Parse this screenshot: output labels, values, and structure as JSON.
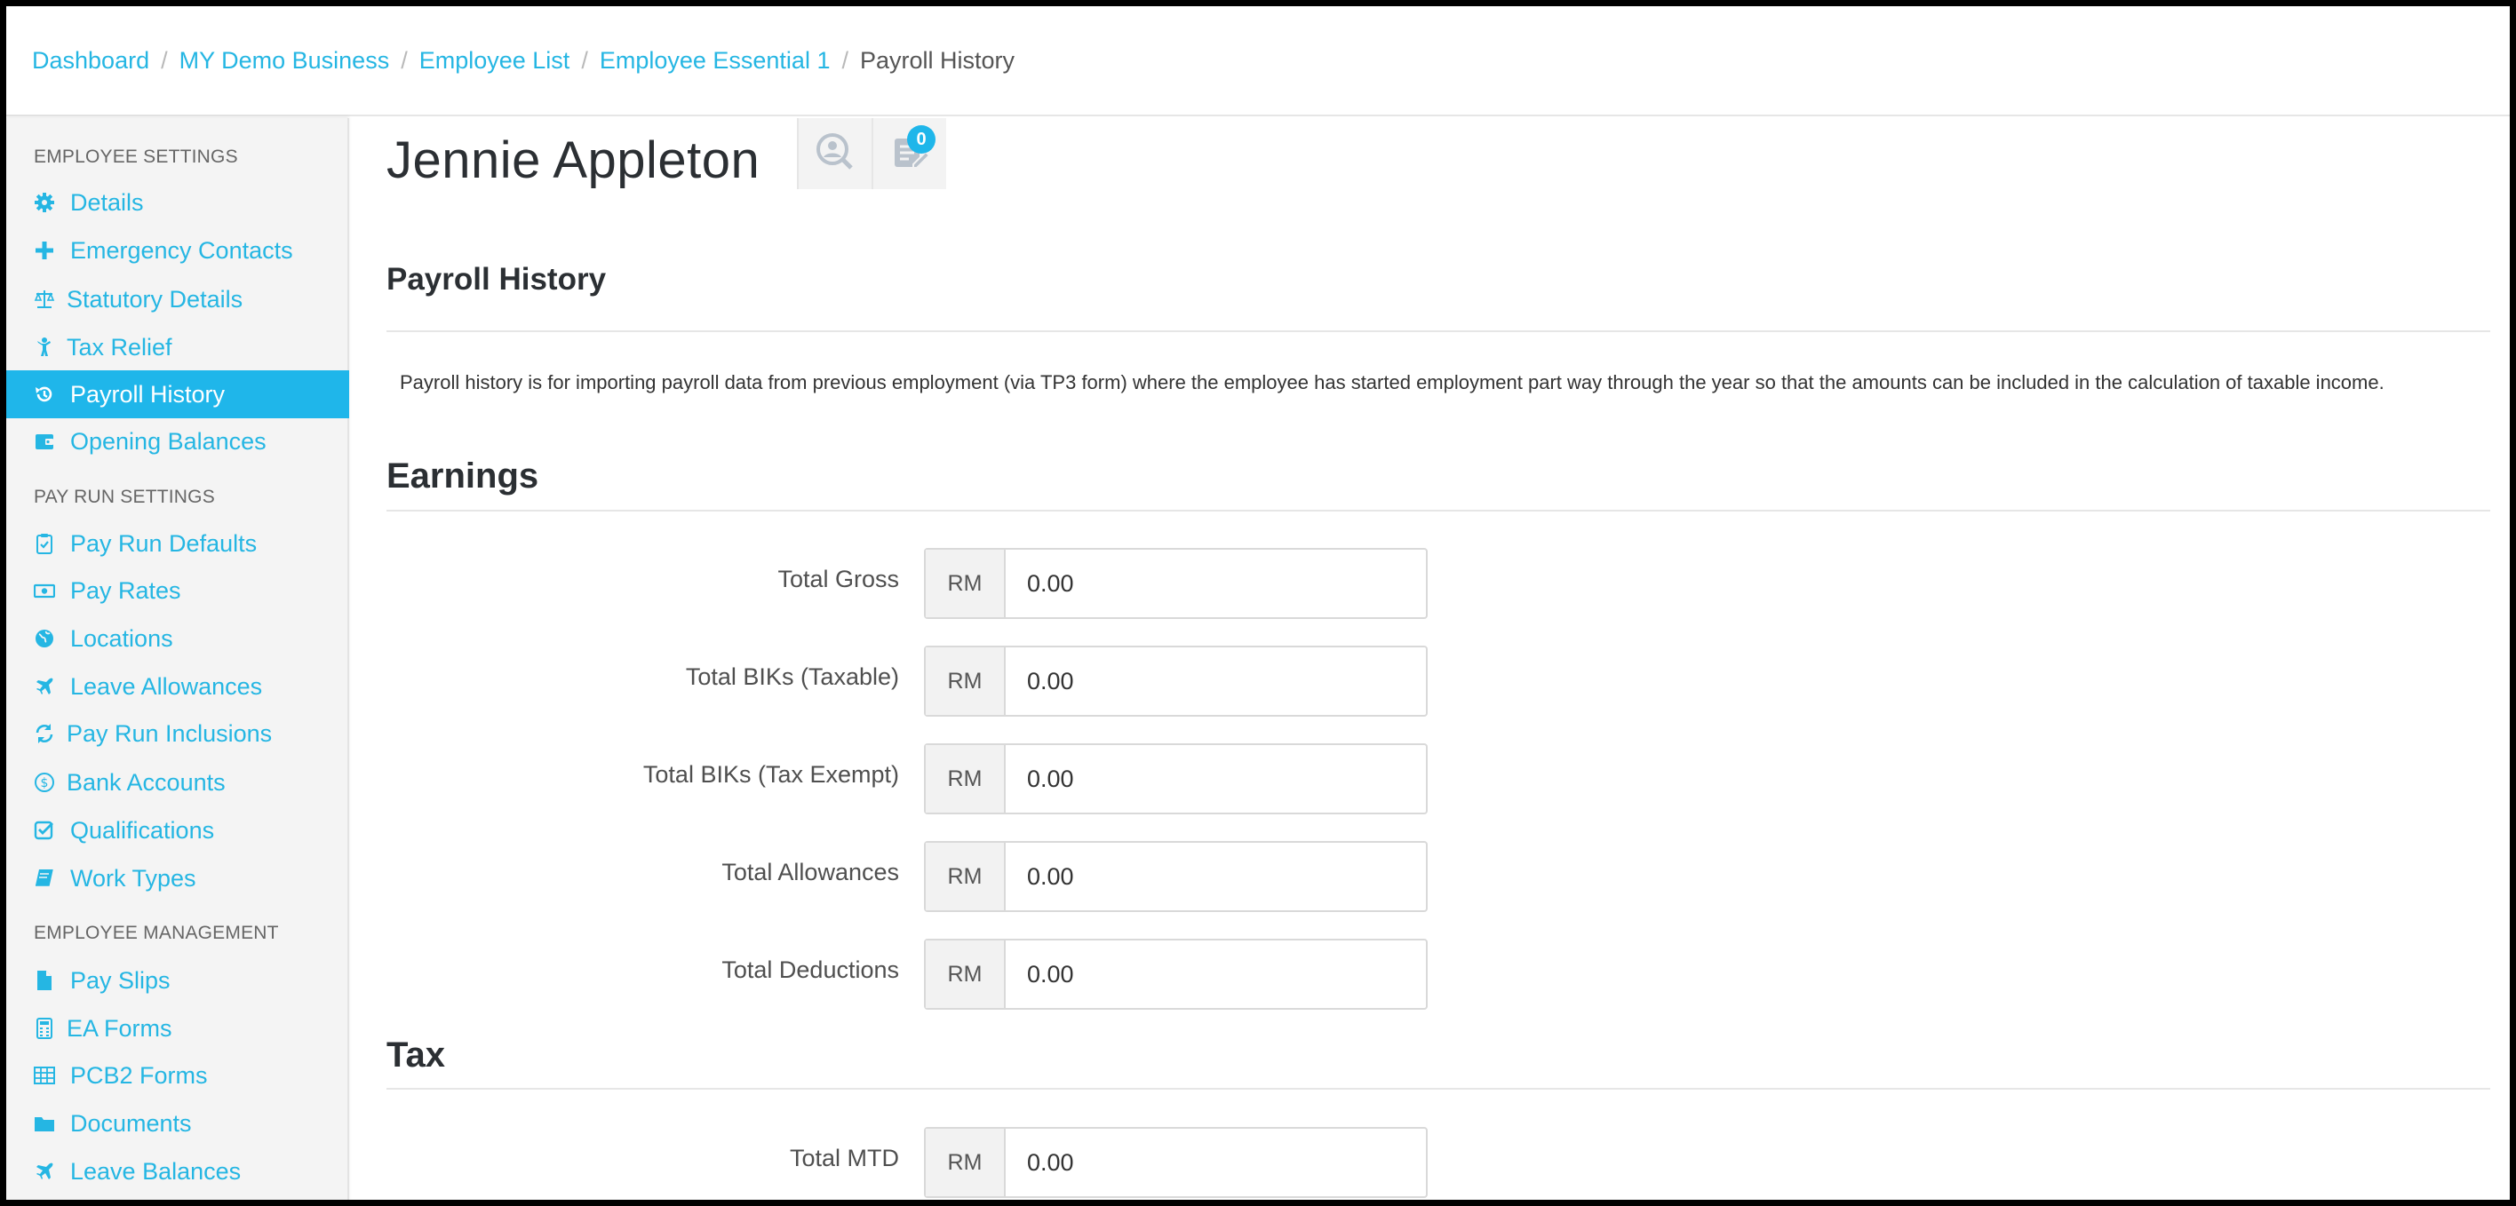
{
  "breadcrumb": {
    "items": [
      "Dashboard",
      "MY Demo Business",
      "Employee List",
      "Employee Essential 1"
    ],
    "current": "Payroll History",
    "separator": "/"
  },
  "sidebar": {
    "sections": [
      {
        "heading": "EMPLOYEE SETTINGS",
        "items": [
          {
            "label": "Details",
            "icon": "gear-icon"
          },
          {
            "label": "Emergency Contacts",
            "icon": "plus-icon"
          },
          {
            "label": "Statutory Details",
            "icon": "balance-scale-icon"
          },
          {
            "label": "Tax Relief",
            "icon": "child-icon"
          },
          {
            "label": "Payroll History",
            "icon": "history-icon",
            "active": true
          },
          {
            "label": "Opening Balances",
            "icon": "wallet-icon"
          }
        ]
      },
      {
        "heading": "PAY RUN SETTINGS",
        "items": [
          {
            "label": "Pay Run Defaults",
            "icon": "clipboard-check-icon"
          },
          {
            "label": "Pay Rates",
            "icon": "money-bill-icon"
          },
          {
            "label": "Locations",
            "icon": "globe-icon"
          },
          {
            "label": "Leave Allowances",
            "icon": "plane-icon"
          },
          {
            "label": "Pay Run Inclusions",
            "icon": "refresh-icon"
          },
          {
            "label": "Bank Accounts",
            "icon": "dollar-circle-icon"
          },
          {
            "label": "Qualifications",
            "icon": "checkbox-icon"
          },
          {
            "label": "Work Types",
            "icon": "book-icon"
          }
        ]
      },
      {
        "heading": "EMPLOYEE MANAGEMENT",
        "items": [
          {
            "label": "Pay Slips",
            "icon": "file-icon"
          },
          {
            "label": "EA Forms",
            "icon": "calculator-icon"
          },
          {
            "label": "PCB2 Forms",
            "icon": "table-icon"
          },
          {
            "label": "Documents",
            "icon": "folder-icon"
          },
          {
            "label": "Leave Balances",
            "icon": "plane-icon"
          }
        ]
      }
    ]
  },
  "employee": {
    "name": "Jennie Appleton",
    "notes_count": "0"
  },
  "page": {
    "title": "Payroll History",
    "intro": "Payroll history is for importing payroll data from previous employment (via TP3 form) where the employee has started employment part way through the year so that the amounts can be included in the calculation of taxable income."
  },
  "earnings": {
    "title": "Earnings",
    "currency": "RM",
    "fields": [
      {
        "label": "Total Gross",
        "value": "0.00"
      },
      {
        "label": "Total BIKs (Taxable)",
        "value": "0.00"
      },
      {
        "label": "Total BIKs (Tax Exempt)",
        "value": "0.00"
      },
      {
        "label": "Total Allowances",
        "value": "0.00"
      },
      {
        "label": "Total Deductions",
        "value": "0.00"
      }
    ]
  },
  "tax": {
    "title": "Tax",
    "currency": "RM",
    "fields": [
      {
        "label": "Total MTD",
        "value": "0.00"
      }
    ]
  },
  "colors": {
    "accent": "#1fb6ea",
    "link": "#25b6e3",
    "heading": "#2b2f33"
  }
}
